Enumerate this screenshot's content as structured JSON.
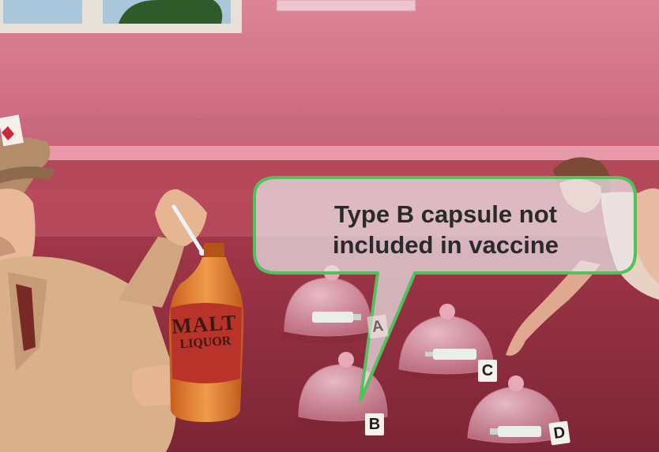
{
  "callout": {
    "line1": "Type B capsule not",
    "line2": "included in vaccine",
    "border_color": "#4fc25a"
  },
  "bottle": {
    "line1": "MALT",
    "line2": "LIQUOR"
  },
  "domes": [
    {
      "label": "A"
    },
    {
      "label": "B"
    },
    {
      "label": "C"
    },
    {
      "label": "D"
    }
  ],
  "colors": {
    "wall": "#d7788a",
    "table": "#8f2f40",
    "coat": "#d9b28e",
    "bottle": "#e07a2e"
  }
}
